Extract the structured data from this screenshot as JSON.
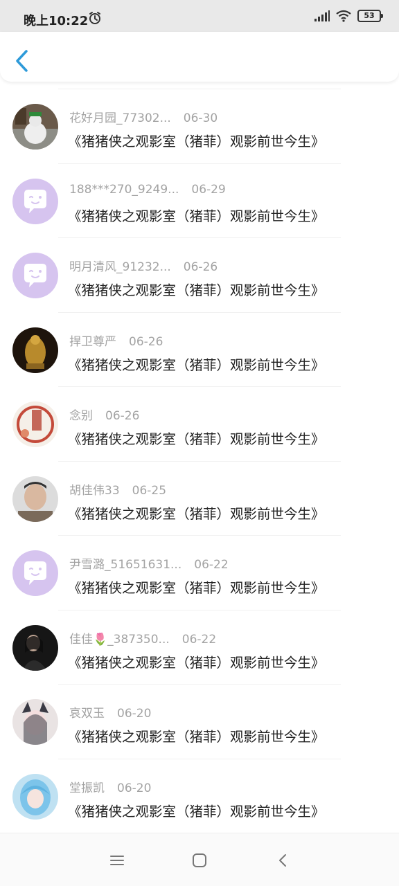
{
  "status_bar": {
    "time": "晚上10:22",
    "battery": "53"
  },
  "items": [
    {
      "user": "花好月园_77302...",
      "date": "06-30",
      "title": "《猪猪侠之观影室（猪菲）观影前世今生》",
      "avatar": "snowman-photo"
    },
    {
      "user": "188***270_9249...",
      "date": "06-29",
      "title": "《猪猪侠之观影室（猪菲）观影前世今生》",
      "avatar": "default-chat-avatar"
    },
    {
      "user": "明月清风_91232...",
      "date": "06-26",
      "title": "《猪猪侠之观影室（猪菲）观影前世今生》",
      "avatar": "default-chat-avatar"
    },
    {
      "user": "捍卫尊严",
      "date": "06-26",
      "title": "《猪猪侠之观影室（猪菲）观影前世今生》",
      "avatar": "golden-statue-photo"
    },
    {
      "user": "念别",
      "date": "06-26",
      "title": "《猪猪侠之观影室（猪菲）观影前世今生》",
      "avatar": "calligraphy-art"
    },
    {
      "user": "胡佳伟33",
      "date": "06-25",
      "title": "《猪猪侠之观影室（猪菲）观影前世今生》",
      "avatar": "face-photo"
    },
    {
      "user": "尹雪潞_51651631...",
      "date": "06-22",
      "title": "《猪猪侠之观影室（猪菲）观影前世今生》",
      "avatar": "default-chat-avatar"
    },
    {
      "user": "佳佳🌷_387350...",
      "date": "06-22",
      "title": "《猪猪侠之观影室（猪菲）观影前世今生》",
      "avatar": "dark-portrait-photo"
    },
    {
      "user": "哀双玉",
      "date": "06-20",
      "title": "《猪猪侠之观影室（猪菲）观影前世今生》",
      "avatar": "anime-character"
    },
    {
      "user": "堂振凯",
      "date": "06-20",
      "title": "《猪猪侠之观影室（猪菲）观影前世今生》",
      "avatar": "blue-hair-anime"
    }
  ],
  "colors": {
    "accent": "#2d9ad9",
    "default_avatar": "#d6c4ef",
    "meta": "#a3a3a3",
    "title": "#222222"
  }
}
